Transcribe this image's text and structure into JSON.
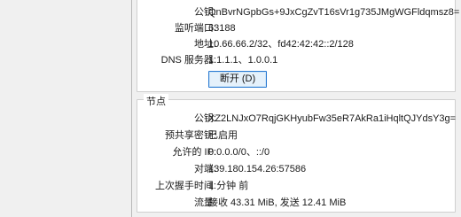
{
  "interface": {
    "fields": [
      {
        "label": "公钥:",
        "value": "QnBvrNGpbGs+9JxCgZvT16sVr1g735JMgWGFldqmsz8="
      },
      {
        "label": "监听端口:",
        "value": "63188"
      },
      {
        "label": "地址:",
        "value": "10.66.66.2/32、fd42:42:42::2/128"
      },
      {
        "label": "DNS 服务器:",
        "value": "1.1.1.1、1.0.0.1"
      }
    ],
    "disconnect_label": "断开 (D)",
    "status_color": "#2e9e3f"
  },
  "peer": {
    "title": "节点",
    "fields": [
      {
        "label": "公钥:",
        "value": "XZ2LNJxO7RqjGKHyubFw35eR7AkRa1iHqltQJYdsY3g="
      },
      {
        "label": "预共享密钥:",
        "value": "已启用"
      },
      {
        "label": "允许的 IP:",
        "value": "0.0.0.0/0、::/0"
      },
      {
        "label": "对端:",
        "value": "139.180.154.26:57586"
      },
      {
        "label": "上次握手时间:",
        "value": "1 分钟 前"
      },
      {
        "label": "流量:",
        "value": "接收 43.31 MiB, 发送 12.41 MiB"
      }
    ]
  }
}
